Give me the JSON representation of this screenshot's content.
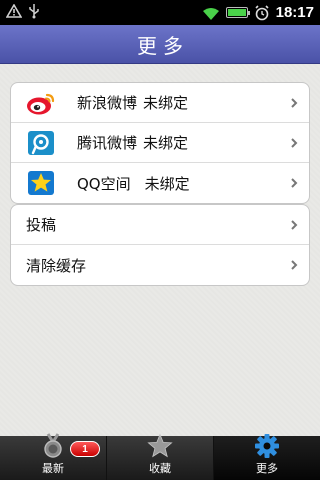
{
  "status_bar": {
    "time": "18:17",
    "icons": [
      "warning-icon",
      "usb-icon",
      "wifi-icon",
      "battery-icon",
      "alarm-icon"
    ]
  },
  "header": {
    "title": "更多"
  },
  "bindings": {
    "label": "未绑定",
    "items": [
      {
        "name": "新浪微博",
        "status": "未绑定",
        "icon": "sina-weibo-icon"
      },
      {
        "name": "腾讯微博",
        "status": "未绑定",
        "icon": "tencent-weibo-icon"
      },
      {
        "name": "QQ空间",
        "status": "未绑定",
        "icon": "qzone-icon"
      }
    ]
  },
  "actions": {
    "items": [
      {
        "label": "投稿"
      },
      {
        "label": "清除缓存"
      }
    ]
  },
  "tabbar": {
    "tabs": [
      {
        "label": "最新",
        "icon": "medal-icon",
        "badge": "1"
      },
      {
        "label": "收藏",
        "icon": "star-icon"
      },
      {
        "label": "更多",
        "icon": "gear-icon",
        "active": true
      }
    ]
  },
  "colors": {
    "title_bar": "#5860b6",
    "background": "#e9e9e7",
    "tab_active": "#050505",
    "badge": "#e00000"
  }
}
